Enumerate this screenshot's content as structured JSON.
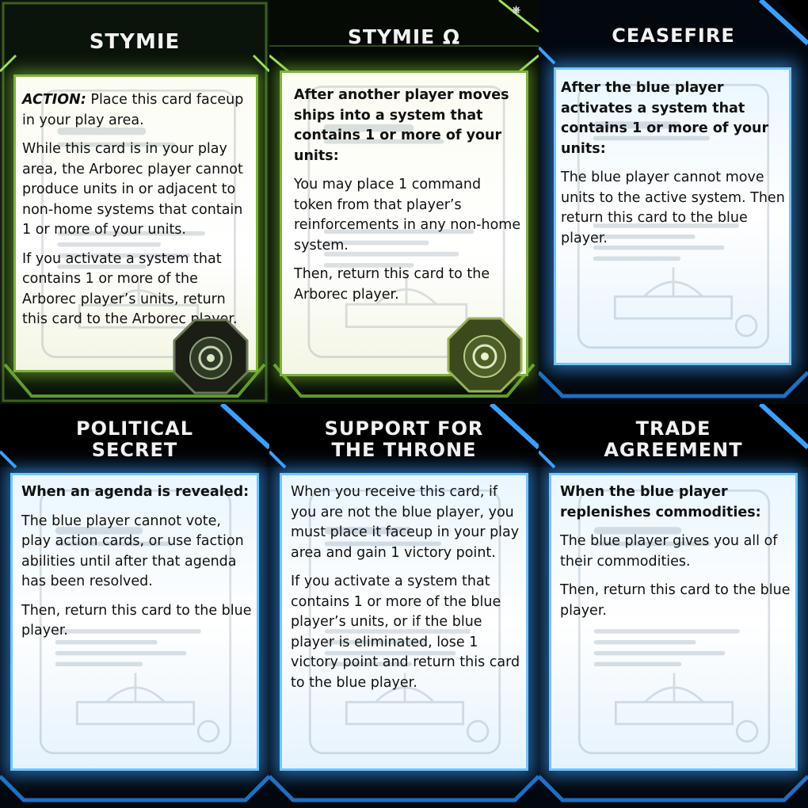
{
  "cards": [
    {
      "title": "STYMIE",
      "action_label": "ACTION:",
      "action_text": " Place this card faceup in your play area.",
      "p2": "While this card is in your play area, the Arborec player cannot produce units in or adjacent to non-home systems that contain 1 or more of your units.",
      "p3": "If you activate a system that contains 1 or more of the Arborec player’s units, return this card to the Arborec player.",
      "badge_icon": "arborec-faction-icon"
    },
    {
      "title": "STYMIE Ω",
      "heading": "After another player moves ships into a system that contains 1 or more of your units:",
      "p2": "You may place 1 command token from that player’s reinforcements in any non-home system.",
      "p3": "Then, return this card to the Arborec player.",
      "badge_icon": "arborec-faction-icon"
    },
    {
      "title": "CEASEFIRE",
      "heading": "After the blue player activates a system that contains 1 or more of your units:",
      "p2": "The blue player cannot move units to the active system. Then return this card to the blue player."
    },
    {
      "title_line1": "POLITICAL",
      "title_line2": "SECRET",
      "heading": "When an agenda is revealed:",
      "p2": "The blue player cannot vote, play action cards, or use faction abilities until after that agenda has been resolved.",
      "p3": "Then, return this card to the blue player."
    },
    {
      "title_line1": "SUPPORT FOR",
      "title_line2": "THE THRONE",
      "p1": "When you receive this card, if you are not the blue player, you must place it faceup in your play area and gain 1 victory point.",
      "p2": "If you activate a system that contains 1 or more of the blue player’s units, or if the blue player is eliminated, lose 1 victory point and return this card to the blue player."
    },
    {
      "title_line1": "TRADE",
      "title_line2": "AGREEMENT",
      "heading": "When the blue player replenishes commodities:",
      "p2": "The blue player gives you all of their commodities.",
      "p3": "Then, return this card to the blue player."
    }
  ],
  "colors": {
    "arborec_green": "#7fb13a",
    "blue_glow": "#3aa0ff",
    "title_text": "#f2f2f2"
  }
}
